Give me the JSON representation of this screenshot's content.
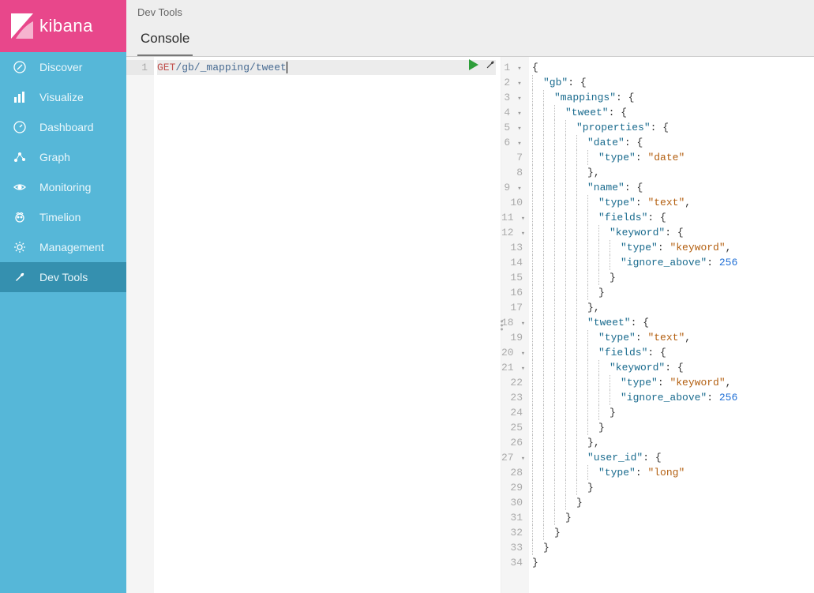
{
  "brand": {
    "name": "kibana"
  },
  "sidebar": {
    "items": [
      {
        "label": "Discover",
        "icon": "compass-icon"
      },
      {
        "label": "Visualize",
        "icon": "bar-chart-icon"
      },
      {
        "label": "Dashboard",
        "icon": "gauge-icon"
      },
      {
        "label": "Graph",
        "icon": "graph-icon"
      },
      {
        "label": "Monitoring",
        "icon": "eye-icon"
      },
      {
        "label": "Timelion",
        "icon": "timelion-icon"
      },
      {
        "label": "Management",
        "icon": "gear-icon"
      },
      {
        "label": "Dev Tools",
        "icon": "wrench-icon"
      }
    ],
    "active_index": 7
  },
  "header": {
    "breadcrumb": "Dev Tools",
    "tabs": [
      {
        "label": "Console"
      }
    ],
    "active_tab": 0
  },
  "editor": {
    "method": "GET",
    "path": "/gb/_mapping/tweet",
    "line_number": "1"
  },
  "response_raw_lines": [
    "{",
    "  \"gb\": {",
    "    \"mappings\": {",
    "      \"tweet\": {",
    "        \"properties\": {",
    "          \"date\": {",
    "            \"type\": \"date\"",
    "          },",
    "          \"name\": {",
    "            \"type\": \"text\",",
    "            \"fields\": {",
    "              \"keyword\": {",
    "                \"type\": \"keyword\",",
    "                \"ignore_above\": 256",
    "              }",
    "            }",
    "          },",
    "          \"tweet\": {",
    "            \"type\": \"text\",",
    "            \"fields\": {",
    "              \"keyword\": {",
    "                \"type\": \"keyword\",",
    "                \"ignore_above\": 256",
    "              }",
    "            }",
    "          },",
    "          \"user_id\": {",
    "            \"type\": \"long\"",
    "          }",
    "        }",
    "      }",
    "    }",
    "  }",
    "}"
  ],
  "colors": {
    "brand_pink": "#e8478b",
    "sidebar_blue": "#56b7d8",
    "sidebar_active": "#3590af",
    "method_red": "#c0504d",
    "path_blue": "#486b92",
    "key_teal": "#1a6b8e",
    "string_orange": "#b35f10",
    "number_blue": "#1f6fd6",
    "play_green": "#2e9e3a"
  }
}
